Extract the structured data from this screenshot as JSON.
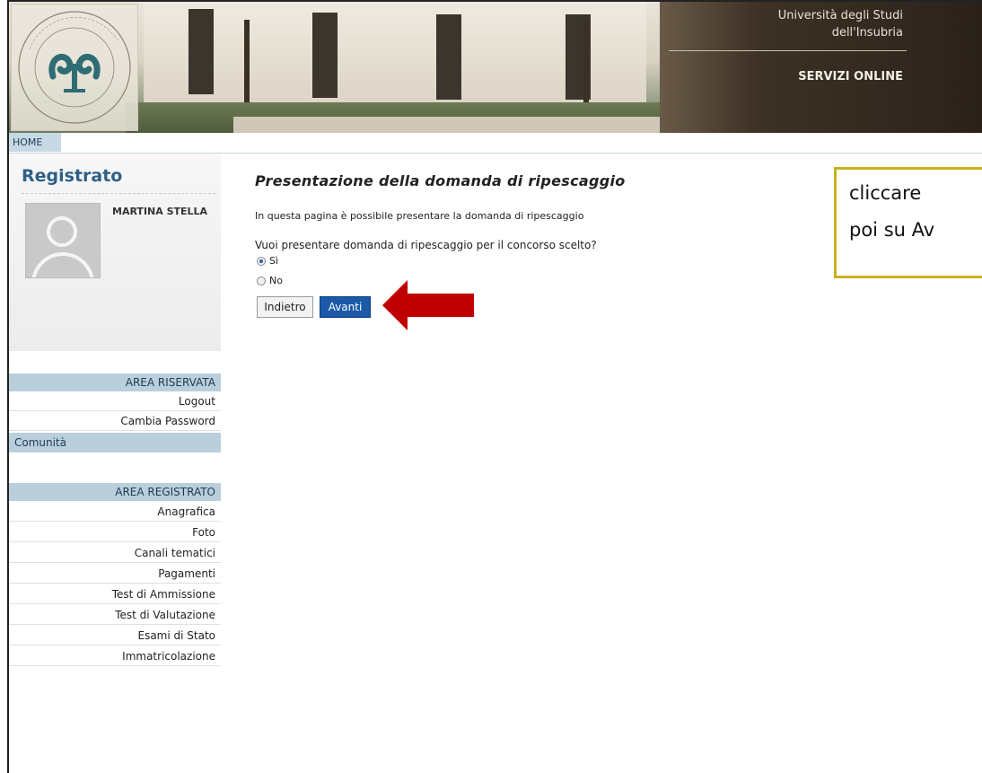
{
  "header": {
    "university_line1": "Università degli Studi",
    "university_line2": "dell'Insubria",
    "services": "SERVIZI ONLINE"
  },
  "nav": {
    "home": "HOME"
  },
  "sidebar": {
    "title": "Registrato",
    "user_name": "MARTINA STELLA",
    "area_riservata": {
      "heading": "AREA RISERVATA",
      "items": [
        "Logout",
        "Cambia Password"
      ]
    },
    "community": "Comunità",
    "area_registrato": {
      "heading": "AREA REGISTRATO",
      "items": [
        "Anagrafica",
        "Foto",
        "Canali tematici",
        "Pagamenti",
        "Test di Ammissione",
        "Test di Valutazione",
        "Esami di Stato",
        "Immatricolazione"
      ]
    }
  },
  "main": {
    "title": "Presentazione della domanda di ripescaggio",
    "intro": "In questa pagina è possibile presentare la domanda di ripescaggio",
    "question": "Vuoi presentare domanda di ripescaggio per il concorso scelto?",
    "options": [
      {
        "label": "Sì",
        "checked": true
      },
      {
        "label": "No",
        "checked": false
      }
    ],
    "back_label": "Indietro",
    "next_label": "Avanti"
  },
  "callout": {
    "line1": "cliccare",
    "line2": "poi su Av"
  },
  "colors": {
    "accent": "#1b5aa8",
    "arrow": "#c00000",
    "callout_border": "#c7b21d",
    "section_bg": "#b9cfdc",
    "title_blue": "#2e5f86"
  }
}
